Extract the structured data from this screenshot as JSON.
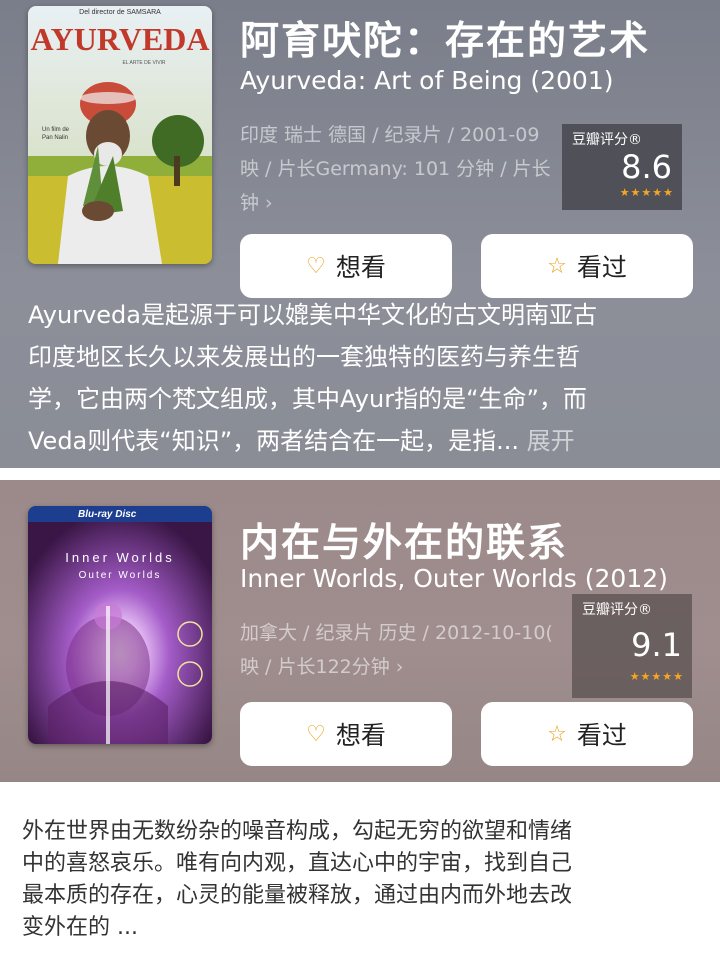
{
  "card1": {
    "poster": {
      "top_text": "Del director de SAMSARA",
      "title": "AYURVEDA",
      "subtitle": "EL ARTE DE VIVIR",
      "credit": "Un film de\nPan Nalin"
    },
    "title_cn": "阿育吠陀：存在的艺术",
    "title_en": "Ayurveda: Art of Being (2001)",
    "meta_lines": [
      "印度 瑞士 德国 / 纪录片 / 2001-09",
      "映 / 片长Germany: 101 分钟 / 片长",
      "钟 ›"
    ],
    "rating": {
      "label": "豆瓣评分®",
      "score": "8.6",
      "stars": "★★★★★"
    },
    "btn_want": "想看",
    "btn_seen": "看过",
    "description_lines": [
      "Ayurveda是起源于可以媲美中华文化的古文明南亚古",
      "印度地区长久以来发展出的一套独特的医药与养生哲",
      "学，它由两个梵文组成，其中Ayur指的是“生命”，而",
      "Veda则代表“知识”，两者结合在一起，是指... "
    ],
    "more_label": "展开"
  },
  "card2": {
    "poster": {
      "top_text": "Blu-ray Disc",
      "title": "Inner Worlds",
      "subtitle": "Outer Worlds"
    },
    "title_cn": "内在与外在的联系",
    "title_en": "Inner Worlds, Outer Worlds (2012)",
    "meta_lines": [
      "加拿大 / 纪录片 历史 / 2012-10-10(",
      "映 / 片长122分钟 ›"
    ],
    "rating": {
      "label": "豆瓣评分®",
      "score": "9.1",
      "stars": "★★★★★"
    },
    "btn_want": "想看",
    "btn_seen": "看过",
    "description_lines": [
      "外在世界由无数纷杂的噪音构成，勾起无穷的欲望和情绪",
      "中的喜怒哀乐。唯有向内观，直达心中的宇宙，找到自己",
      "最本质的存在，心灵的能量被释放，通过由内而外地去改",
      "变外在的 ..."
    ]
  },
  "colors": {
    "accent": "#e8a21a",
    "star": "#f5a623"
  },
  "icons": {
    "want": "heart-plus-icon",
    "seen": "star-outline-icon"
  }
}
